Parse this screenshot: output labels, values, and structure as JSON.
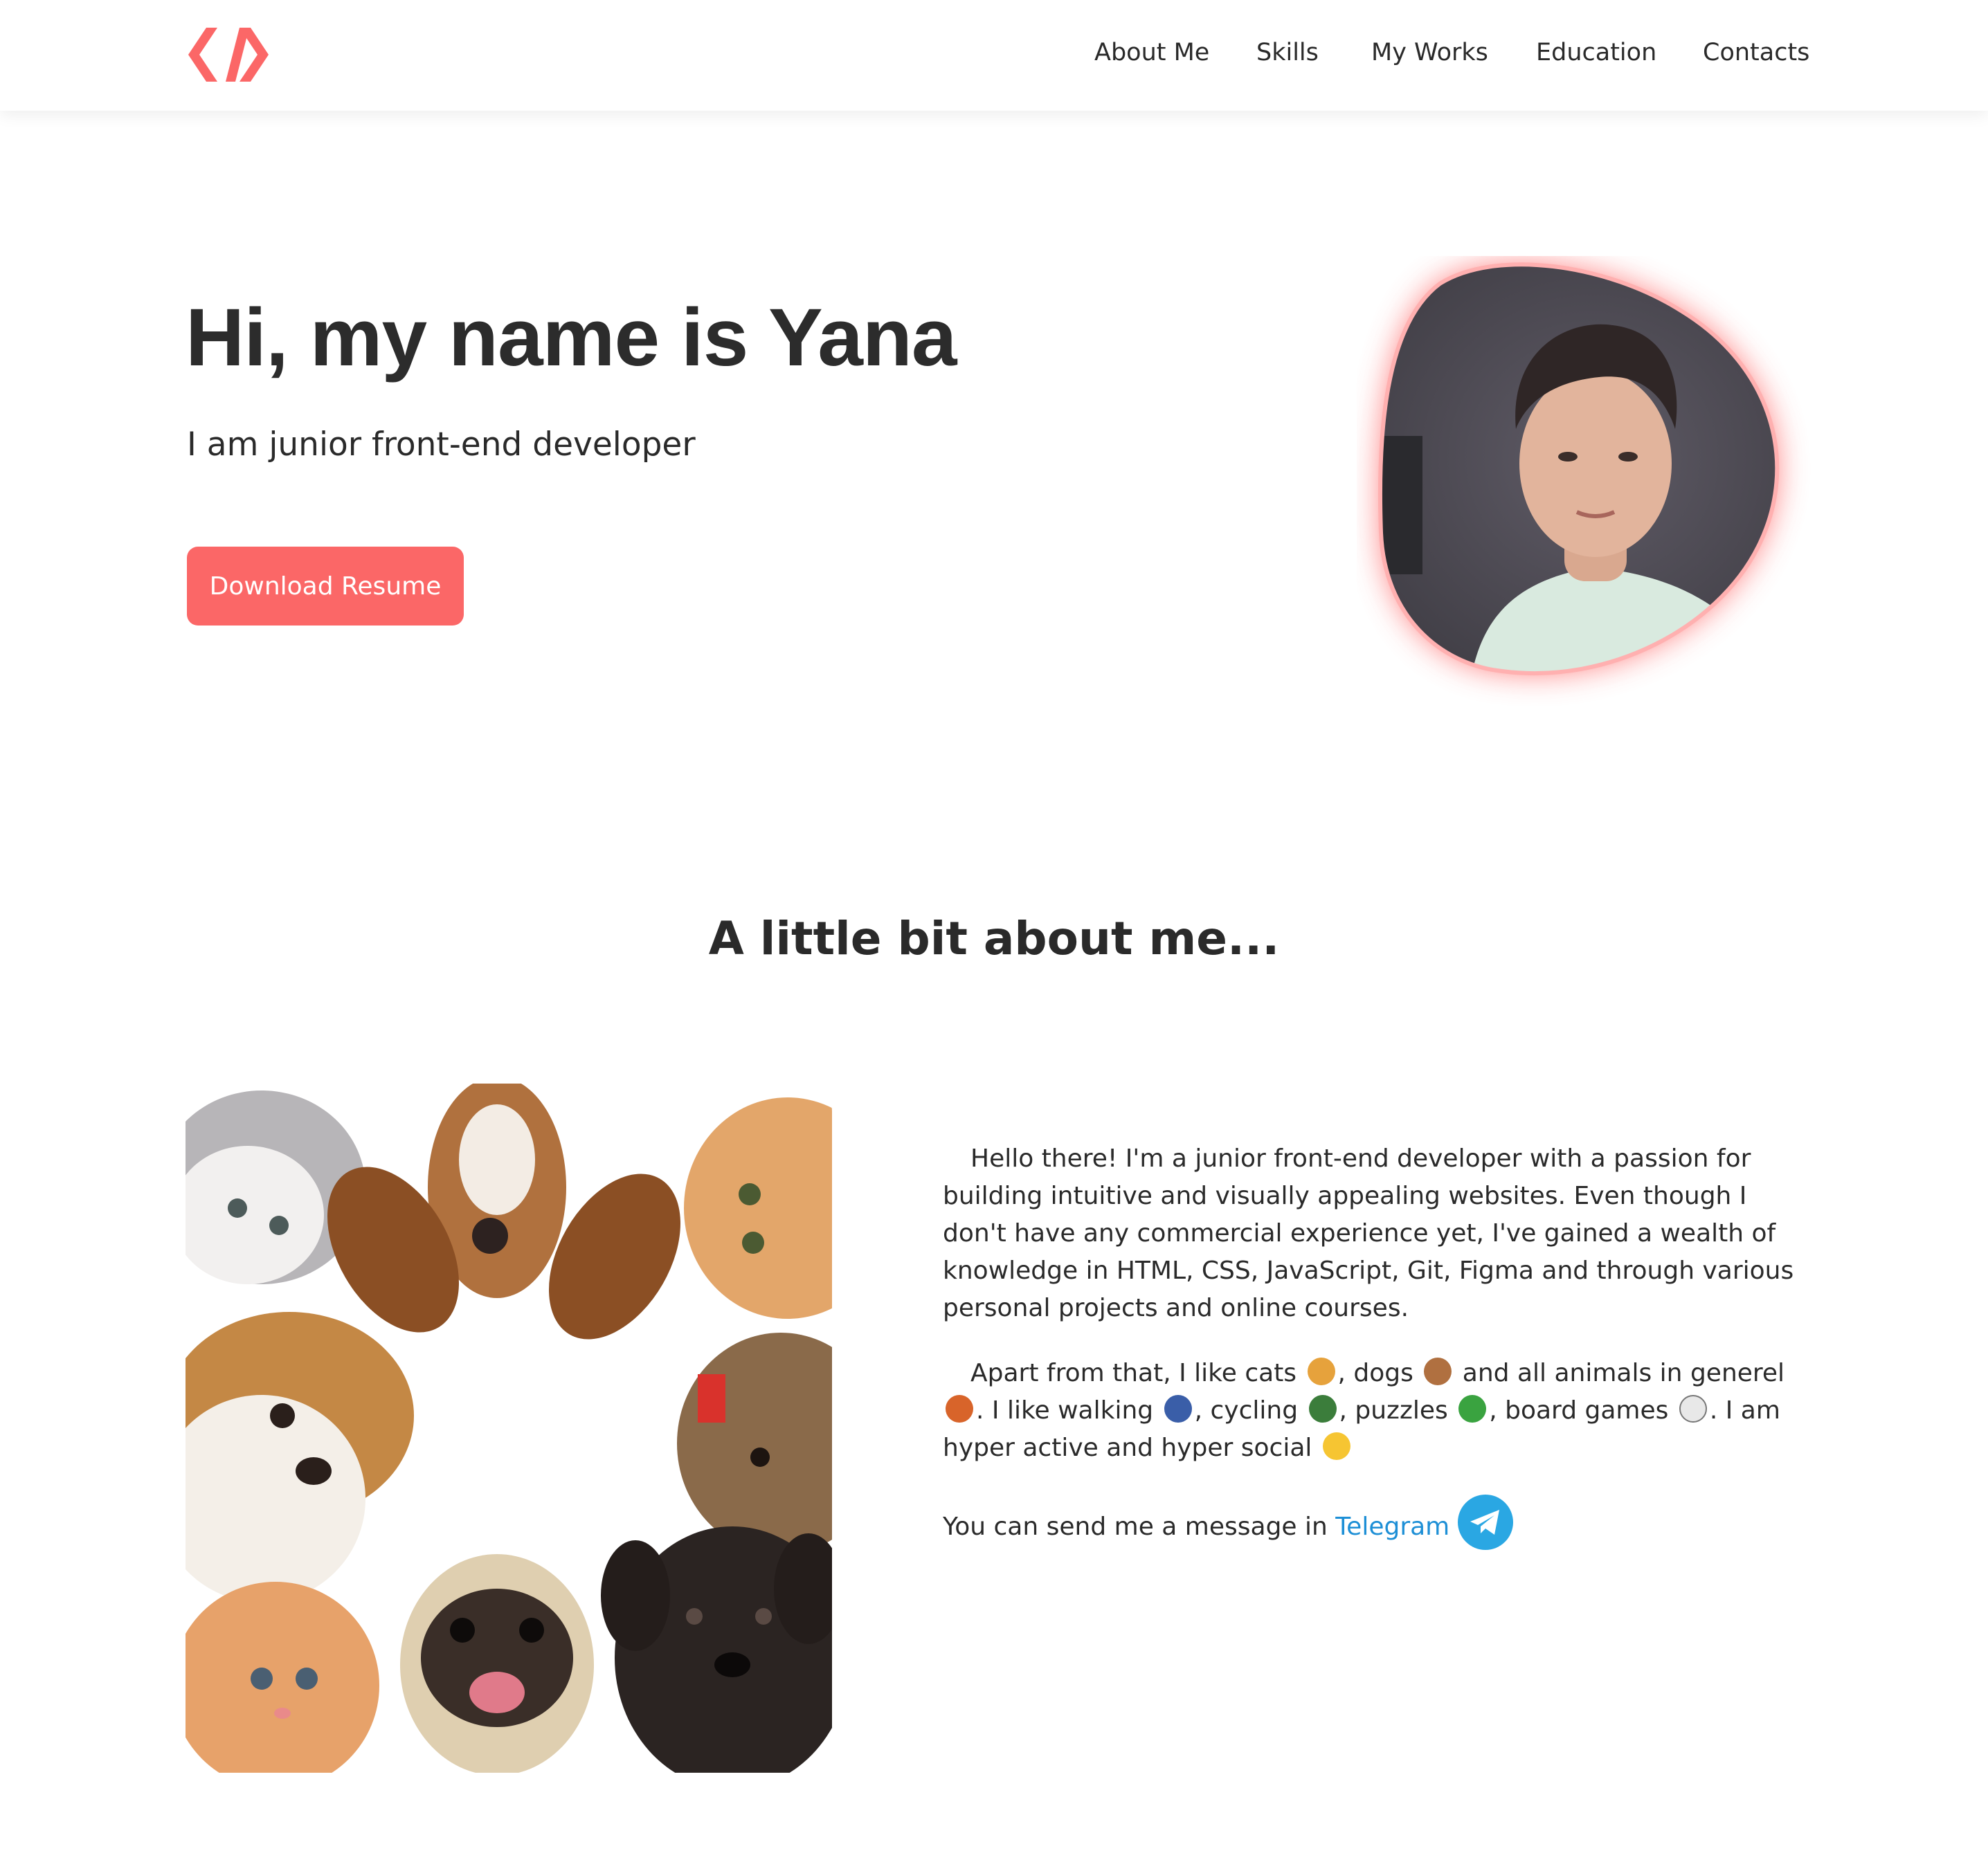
{
  "header": {
    "logo": "code-brackets-icon",
    "nav": [
      "About Me",
      "Skills",
      "My Works",
      "Education",
      "Contacts"
    ]
  },
  "hero": {
    "title": "Hi, my name is Yana",
    "subtitle": "I am junior front-end developer",
    "cta_label": "Download Resume",
    "photo": "profile-photo"
  },
  "about": {
    "title": "A little bit about me...",
    "image": "cats-and-dogs-collage",
    "p1": "Hello there! I'm a junior front-end developer with a passion for building intuitive and visually appealing websites. Even though I don't have any commercial experience yet, I've gained a wealth of knowledge in HTML, CSS, JavaScript, Git, Figma and through various personal projects and online courses.",
    "p2": {
      "t1": "Apart from that, I like cats",
      "t2": ", dogs",
      "t3": " and all animals in generel",
      "t4": ". I like walking",
      "t5": ", cycling",
      "t6": ", puzzles",
      "t7": ", board games",
      "t8": ". I am hyper active and hyper social"
    },
    "p3_text": "You can send me a message in",
    "telegram_label": "Telegram"
  },
  "colors": {
    "accent": "#fb6767",
    "link": "#1d8fd6",
    "text": "#2a2a2a"
  }
}
